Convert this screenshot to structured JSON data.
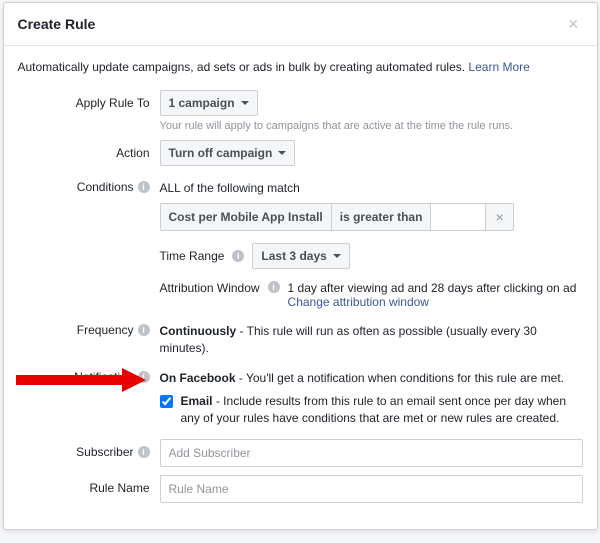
{
  "header": {
    "title": "Create Rule"
  },
  "intro": {
    "text": "Automatically update campaigns, ad sets or ads in bulk by creating automated rules. ",
    "learn_more": "Learn More"
  },
  "apply": {
    "label": "Apply Rule To",
    "value": "1 campaign",
    "helper": "Your rule will apply to campaigns that are active at the time the rule runs."
  },
  "action": {
    "label": "Action",
    "value": "Turn off campaign"
  },
  "conditions": {
    "label": "Conditions",
    "match_text": "ALL of the following match",
    "metric": "Cost per Mobile App Install",
    "operator": "is greater than",
    "value": "",
    "time_range_label": "Time Range",
    "time_range_value": "Last 3 days",
    "attr_label": "Attribution Window",
    "attr_text": "1 day after viewing ad and 28 days after clicking on ad",
    "attr_link": "Change attribution window"
  },
  "frequency": {
    "label": "Frequency",
    "bold": "Continuously",
    "text": " - This rule will run as often as possible (usually every 30 minutes)."
  },
  "notification": {
    "label": "Notification",
    "fb_bold": "On Facebook",
    "fb_text": " - You'll get a notification when conditions for this rule are met.",
    "email_bold": "Email",
    "email_text": " - Include results from this rule to an email sent once per day when any of your rules have conditions that are met or new rules are created."
  },
  "subscriber": {
    "label": "Subscriber",
    "placeholder": "Add Subscriber"
  },
  "rule_name": {
    "label": "Rule Name",
    "placeholder": "Rule Name"
  }
}
